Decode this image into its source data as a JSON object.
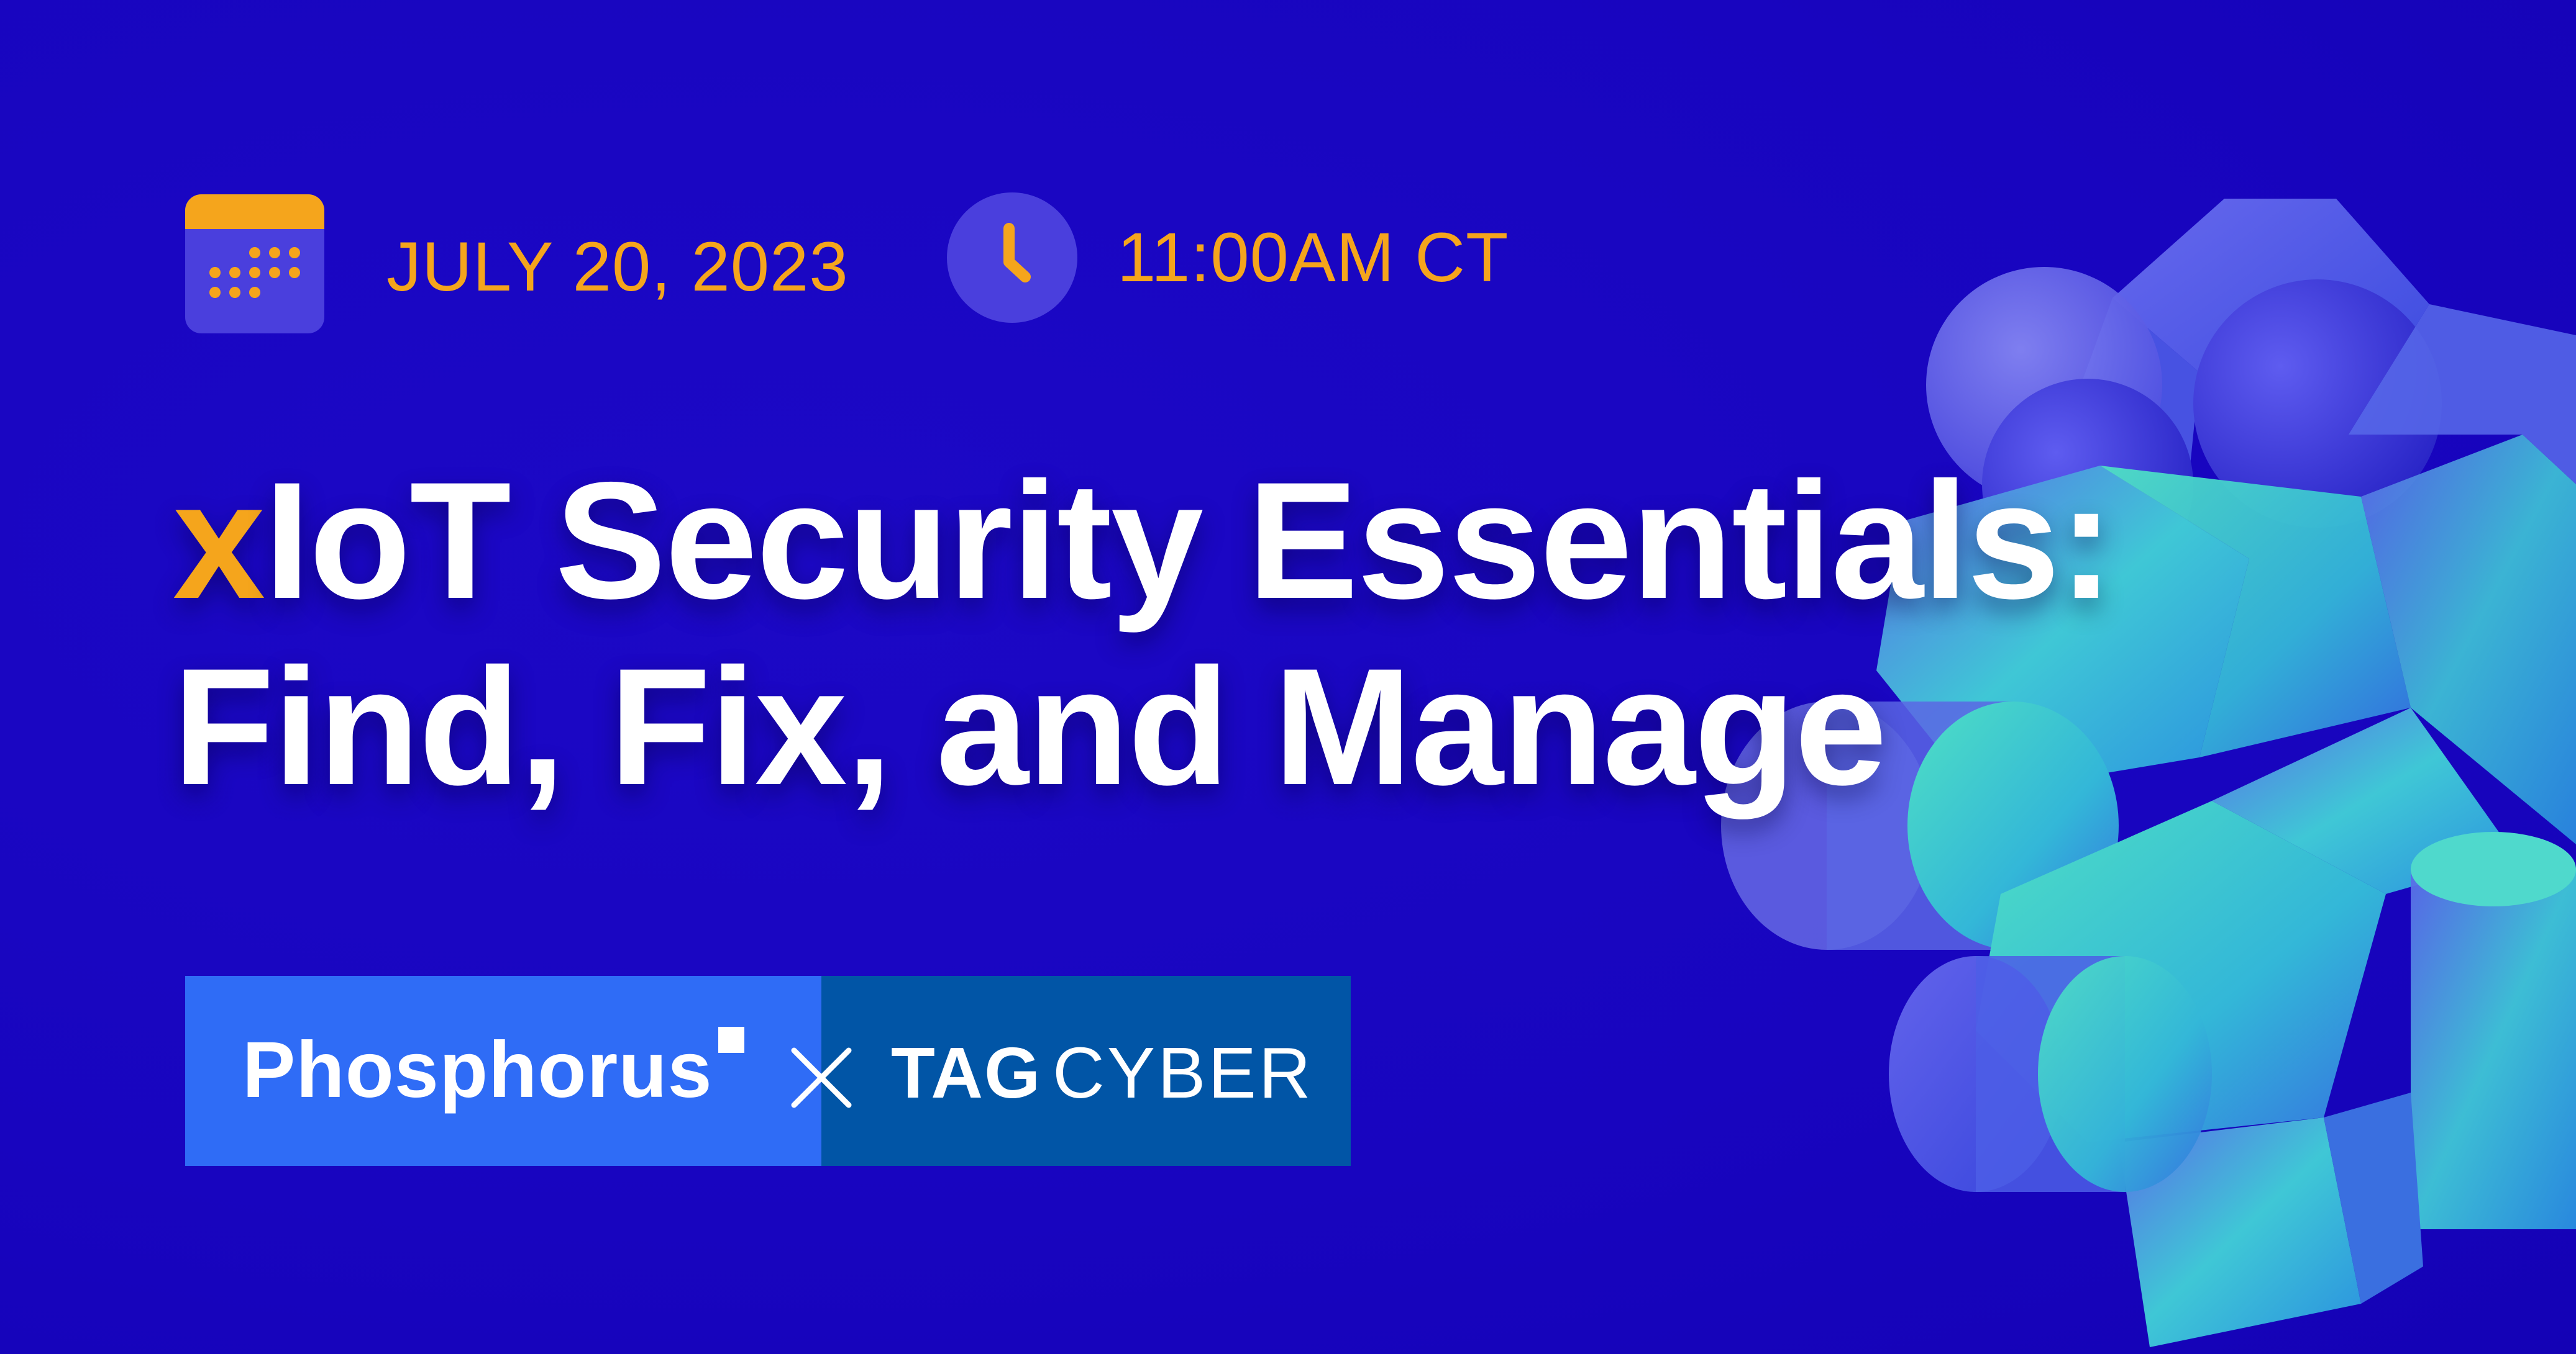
{
  "event": {
    "date": "JULY 20, 2023",
    "time": "11:00AM CT"
  },
  "title": {
    "accent": "x",
    "line1_rest": "IoT Security Essentials:",
    "line2": "Find, Fix, and Manage"
  },
  "partners": {
    "left_brand": "Phosphorus",
    "separator": "×",
    "right_brand_bold": "TAG",
    "right_brand_light": "CYBER"
  },
  "icons": {
    "date": "calendar-icon",
    "time": "clock-icon",
    "separator": "close-x-icon"
  },
  "colors": {
    "background": "#1805bf",
    "accent": "#f5a51c",
    "icon_bg": "#4a3fdd",
    "phosphorus_blue": "#2f6cf6",
    "tagcyber_blue": "#0155a6",
    "text": "#ffffff"
  }
}
